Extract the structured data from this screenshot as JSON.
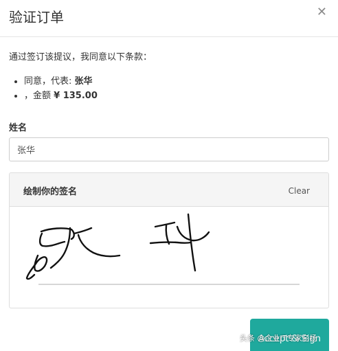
{
  "header": {
    "title": "验证订单"
  },
  "intro_text": "通过签订该提议，我同意以下条款：",
  "terms": [
    {
      "prefix": "同意，代表: ",
      "value": "张华"
    },
    {
      "prefix": "，金额 ",
      "value": "¥ 135.00"
    }
  ],
  "name_field": {
    "label": "姓名",
    "value": "张华"
  },
  "signature": {
    "title": "绘制你的签名",
    "clear_label": "Clear"
  },
  "accept_label": "Accept & Sign",
  "watermark": "头条 @企业IT专家名扬",
  "colors": {
    "accent": "#1fa99d",
    "border": "#dddddd",
    "panel_header": "#f5f5f5"
  },
  "icons": {
    "close": "close-icon"
  }
}
